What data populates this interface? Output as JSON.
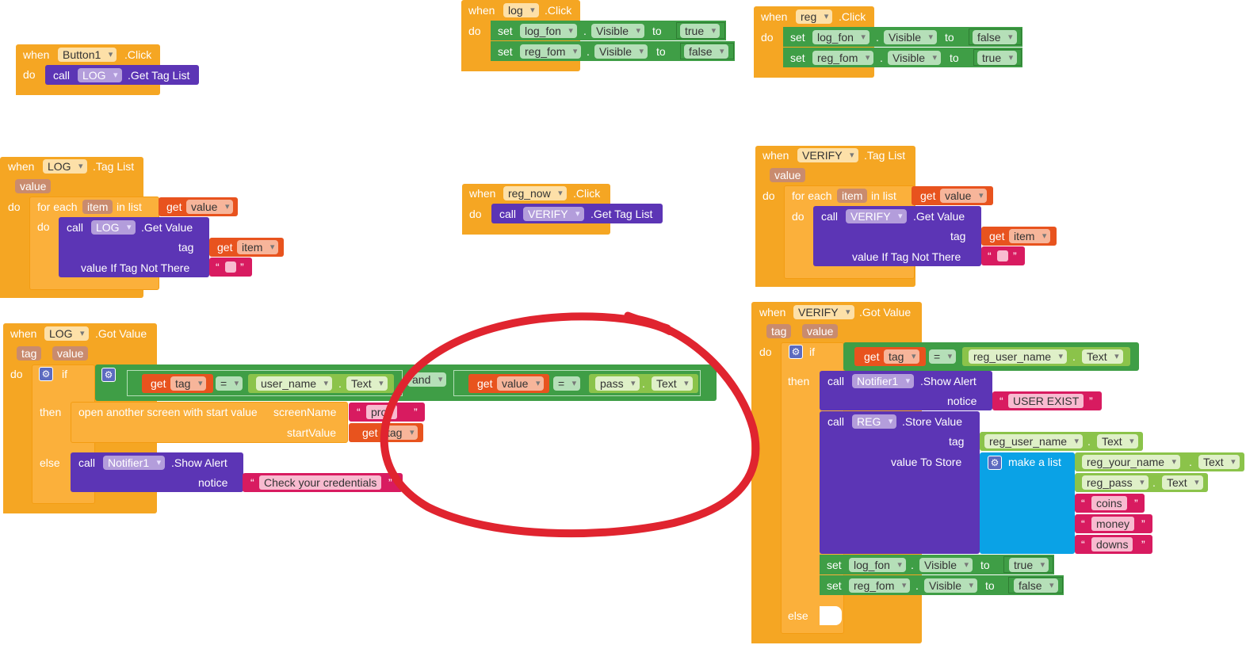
{
  "blocks": {
    "button1_click": {
      "when": "when",
      "component": "Button1",
      "event": ".Click",
      "do": "do",
      "call": "call",
      "target": "LOG",
      "method": ".Get Tag List"
    },
    "log_click": {
      "when": "when",
      "component": "log",
      "event": ".Click",
      "do": "do",
      "set1": {
        "set": "set",
        "comp": "log_fon",
        "dot": ".",
        "prop": "Visible",
        "to": "to",
        "val": "true"
      },
      "set2": {
        "set": "set",
        "comp": "reg_fom",
        "dot": ".",
        "prop": "Visible",
        "to": "to",
        "val": "false"
      }
    },
    "reg_click": {
      "when": "when",
      "component": "reg",
      "event": ".Click",
      "do": "do",
      "set1": {
        "set": "set",
        "comp": "log_fon",
        "dot": ".",
        "prop": "Visible",
        "to": "to",
        "val": "false"
      },
      "set2": {
        "set": "set",
        "comp": "reg_fom",
        "dot": ".",
        "prop": "Visible",
        "to": "to",
        "val": "true"
      }
    },
    "log_taglist": {
      "when": "when",
      "component": "LOG",
      "event": ".Tag List",
      "param": "value",
      "do": "do",
      "for_each": "for each",
      "item": "item",
      "in_list": "in list",
      "get": "get",
      "get_val": "value",
      "do2": "do",
      "call": "call",
      "target": "LOG",
      "method": ".Get Value",
      "tag_label": "tag",
      "get2": "get",
      "get2_val": "item",
      "not_there": "value If Tag Not There",
      "quote_l": "“",
      "quote_r": "”"
    },
    "regnow_click": {
      "when": "when",
      "component": "reg_now",
      "event": ".Click",
      "do": "do",
      "call": "call",
      "target": "VERIFY",
      "method": ".Get Tag List"
    },
    "verify_taglist": {
      "when": "when",
      "component": "VERIFY",
      "event": ".Tag List",
      "param": "value",
      "do": "do",
      "for_each": "for each",
      "item": "item",
      "in_list": "in list",
      "get": "get",
      "get_val": "value",
      "do2": "do",
      "call": "call",
      "target": "VERIFY",
      "method": ".Get Value",
      "tag_label": "tag",
      "get2": "get",
      "get2_val": "item",
      "not_there": "value If Tag Not There",
      "quote_l": "“",
      "quote_r": "”"
    },
    "log_gotvalue": {
      "when": "when",
      "component": "LOG",
      "event": ".Got Value",
      "param1": "tag",
      "param2": "value",
      "do": "do",
      "if": "if",
      "get1": "get",
      "get1_val": "tag",
      "eq1": "=",
      "comp1": "user_name",
      "dot": ".",
      "prop1": "Text",
      "and": "and",
      "get2": "get",
      "get2_val": "value",
      "eq2": "=",
      "comp2": "pass",
      "prop2": "Text",
      "then": "then",
      "open": "open another screen with start value",
      "screen_name": "screenName",
      "quote_l": "“",
      "quote_r": "”",
      "screen_val": "profi",
      "start_value": "startValue",
      "get3": "get",
      "get3_val": "tag",
      "else": "else",
      "call": "call",
      "notifier": "Notifier1",
      "alert": ".Show Alert",
      "notice": "notice",
      "notice_val": "Check your credentials"
    },
    "verify_gotvalue": {
      "when": "when",
      "component": "VERIFY",
      "event": ".Got Value",
      "param1": "tag",
      "param2": "value",
      "do": "do",
      "if": "if",
      "get1": "get",
      "get1_val": "tag",
      "eq": "=",
      "comp1": "reg_user_name",
      "dot": ".",
      "prop1": "Text",
      "then": "then",
      "call1": "call",
      "notifier": "Notifier1",
      "alert": ".Show Alert",
      "notice": "notice",
      "quote_l": "“",
      "quote_r": "”",
      "notice_val": "USER EXIST",
      "call2": "call",
      "reg": "REG",
      "store": ".Store Value",
      "tag_label": "tag",
      "tag_comp": "reg_user_name",
      "tag_prop": "Text",
      "vts": "value To Store",
      "make_list": "make a list",
      "list1_comp": "reg_your_name",
      "list1_prop": "Text",
      "list2_comp": "reg_pass",
      "list2_prop": "Text",
      "s1": "coins",
      "s2": "money",
      "s3": "downs",
      "set1": {
        "set": "set",
        "comp": "log_fon",
        "prop": "Visible",
        "to": "to",
        "val": "true"
      },
      "set2": {
        "set": "set",
        "comp": "reg_fom",
        "prop": "Visible",
        "to": "to",
        "val": "false"
      },
      "else": "else"
    }
  },
  "annotation": {
    "shape": "red-hand-drawn-circle",
    "color": "#e0242f"
  },
  "colors": {
    "event": "#f5a623",
    "procedure": "#5c35b5",
    "setter": "#3f9e46",
    "text_prop": "#8bc34a",
    "getter": "#e8531e",
    "string": "#d81b60",
    "list": "#0aa2e6"
  }
}
